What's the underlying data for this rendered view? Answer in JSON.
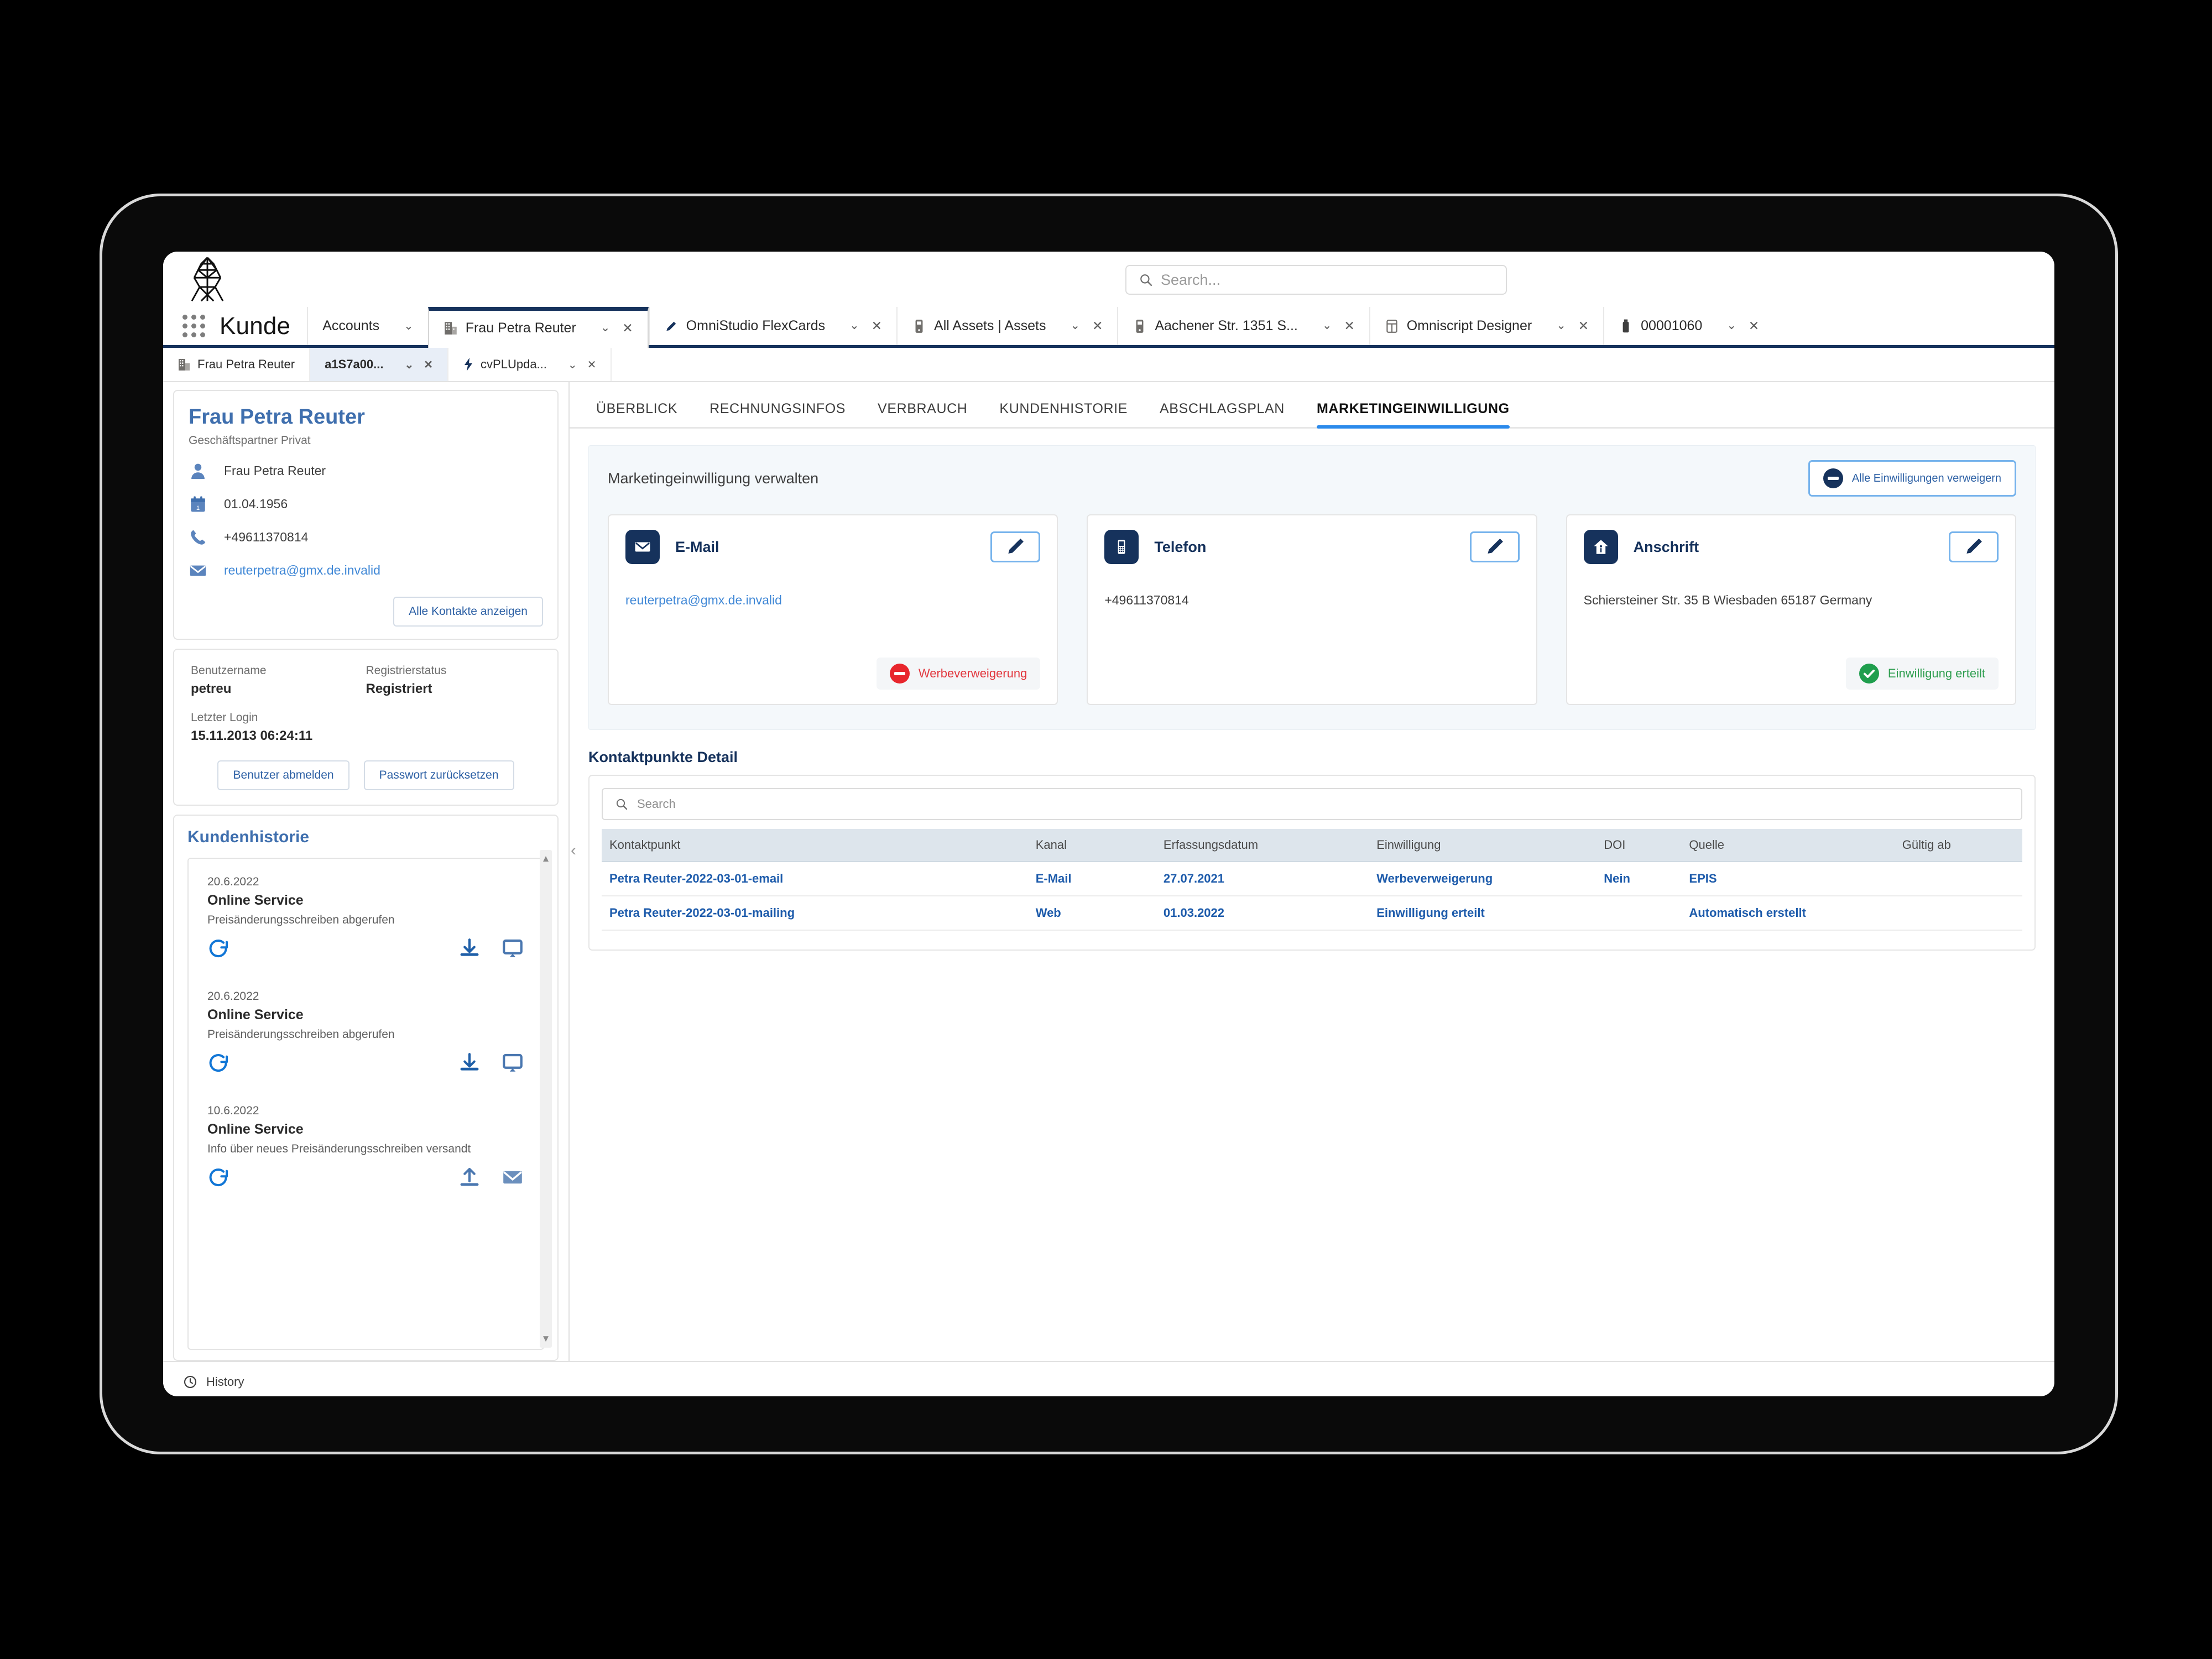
{
  "window": {
    "brand_logo": "power-pylon-logo",
    "app_name": "Kunde"
  },
  "global_search": {
    "icon": "search-icon",
    "placeholder": "Search..."
  },
  "nav_tabs": [
    {
      "label": "Accounts",
      "icon": "none",
      "active": false,
      "has_close": false
    },
    {
      "label": "Frau Petra Reuter",
      "icon": "account-icon",
      "active": true,
      "has_close": true
    },
    {
      "label": "OmniStudio FlexCards",
      "icon": "pencil-icon",
      "active": false,
      "has_close": true
    },
    {
      "label": "All Assets | Assets",
      "icon": "asset-icon",
      "active": false,
      "has_close": true
    },
    {
      "label": "Aachener Str. 1351 S...",
      "icon": "asset-icon",
      "active": false,
      "has_close": true
    },
    {
      "label": "Omniscript Designer",
      "icon": "omniscript-icon",
      "active": false,
      "has_close": true
    },
    {
      "label": "00001060",
      "icon": "order-icon",
      "active": false,
      "has_close": true
    }
  ],
  "sub_tabs": [
    {
      "label": "Frau Petra Reuter",
      "icon": "account-icon",
      "selected": false,
      "has_close": false
    },
    {
      "label": "a1S7a00...",
      "icon": "none",
      "selected": true,
      "has_close": true
    },
    {
      "label": "cvPLUpda...",
      "icon": "flow-icon",
      "selected": false,
      "has_close": true
    }
  ],
  "highlights": {
    "name": "Frau Petra Reuter",
    "record_type": "Geschäftspartner Privat",
    "fields": [
      {
        "icon": "person-icon",
        "value": "Frau Petra Reuter",
        "is_link": false
      },
      {
        "icon": "calendar-icon",
        "value": "01.04.1956",
        "is_link": false
      },
      {
        "icon": "phone-icon",
        "value": "+49611370814",
        "is_link": false
      },
      {
        "icon": "email-icon",
        "value": "reuterpetra@gmx.de.invalid",
        "is_link": true
      }
    ],
    "all_contacts_button": "Alle Kontakte anzeigen"
  },
  "user_card": {
    "username_label": "Benutzername",
    "username_value": "petreu",
    "status_label": "Registrierstatus",
    "status_value": "Registriert",
    "last_login_label": "Letzter Login",
    "last_login_value": "15.11.2013 06:24:11",
    "logout_button": "Benutzer abmelden",
    "reset_button": "Passwort zurücksetzen"
  },
  "history_panel": {
    "title": "Kundenhistorie",
    "items": [
      {
        "date": "20.6.2022",
        "headline": "Online Service",
        "description": "Preisänderungsschreiben abgerufen",
        "left_icon": "refresh-icon",
        "right_icons": [
          "download-icon",
          "monitor-icon"
        ]
      },
      {
        "date": "20.6.2022",
        "headline": "Online Service",
        "description": "Preisänderungsschreiben abgerufen",
        "left_icon": "refresh-icon",
        "right_icons": [
          "download-icon",
          "monitor-icon"
        ]
      },
      {
        "date": "10.6.2022",
        "headline": "Online Service",
        "description": "Info über neues Preisänderungsschreiben versandt",
        "left_icon": "refresh-icon",
        "right_icons": [
          "upload-icon",
          "email-icon"
        ]
      }
    ],
    "scroll_up": "▲",
    "scroll_down": "▼"
  },
  "record_tabs": [
    {
      "label": "ÜBERBLICK",
      "active": false
    },
    {
      "label": "RECHNUNGSINFOS",
      "active": false
    },
    {
      "label": "VERBRAUCH",
      "active": false
    },
    {
      "label": "KUNDENHISTORIE",
      "active": false
    },
    {
      "label": "ABSCHLAGSPLAN",
      "active": false
    },
    {
      "label": "MARKETINGEINWILLIGUNG",
      "active": true
    }
  ],
  "marketing": {
    "panel_title": "Marketingeinwilligung verwalten",
    "deny_all_button": "Alle Einwilligungen verweigern",
    "deny_all_icon": "minus-circle-icon",
    "cards": [
      {
        "title": "E-Mail",
        "icon": "envelope-icon",
        "value": "reuterpetra@gmx.de.invalid",
        "value_is_link": true,
        "edit_icon": "pencil-icon",
        "status": "Werbeverweigerung",
        "status_type": "deny",
        "status_icon": "minus-circle-icon"
      },
      {
        "title": "Telefon",
        "icon": "mobile-phone-icon",
        "value": "+49611370814",
        "value_is_link": false,
        "edit_icon": "pencil-icon",
        "status": "",
        "status_type": "none",
        "status_icon": ""
      },
      {
        "title": "Anschrift",
        "icon": "home-icon",
        "value": "Schiersteiner Str. 35 B Wiesbaden 65187 Germany",
        "value_is_link": false,
        "edit_icon": "pencil-icon",
        "status": "Einwilligung erteilt",
        "status_type": "grant",
        "status_icon": "check-circle-icon"
      }
    ]
  },
  "contact_points": {
    "title": "Kontaktpunkte Detail",
    "search": {
      "icon": "search-icon",
      "placeholder": "Search"
    },
    "columns": [
      "Kontaktpunkt",
      "Kanal",
      "Erfassungsdatum",
      "Einwilligung",
      "DOI",
      "Quelle",
      "Gültig ab"
    ],
    "rows": [
      {
        "kontaktpunkt": "Petra Reuter-2022-03-01-email",
        "kanal": "E-Mail",
        "erfassungsdatum": "27.07.2021",
        "einwilligung": "Werbeverweigerung",
        "doi": "Nein",
        "quelle": "EPIS",
        "gueltig_ab": ""
      },
      {
        "kontaktpunkt": "Petra Reuter-2022-03-01-mailing",
        "kanal": "Web",
        "erfassungsdatum": "01.03.2022",
        "einwilligung": "Einwilligung erteilt",
        "doi": "",
        "quelle": "Automatisch erstellt",
        "gueltig_ab": ""
      }
    ]
  },
  "footer": {
    "history_label": "History",
    "history_icon": "clock-icon"
  },
  "colors": {
    "brand_navy": "#16325c",
    "link_blue": "#1d5bab",
    "accent_blue": "#2b8aeb",
    "deny_red": "#e8262d",
    "grant_green": "#1f9e4d"
  }
}
